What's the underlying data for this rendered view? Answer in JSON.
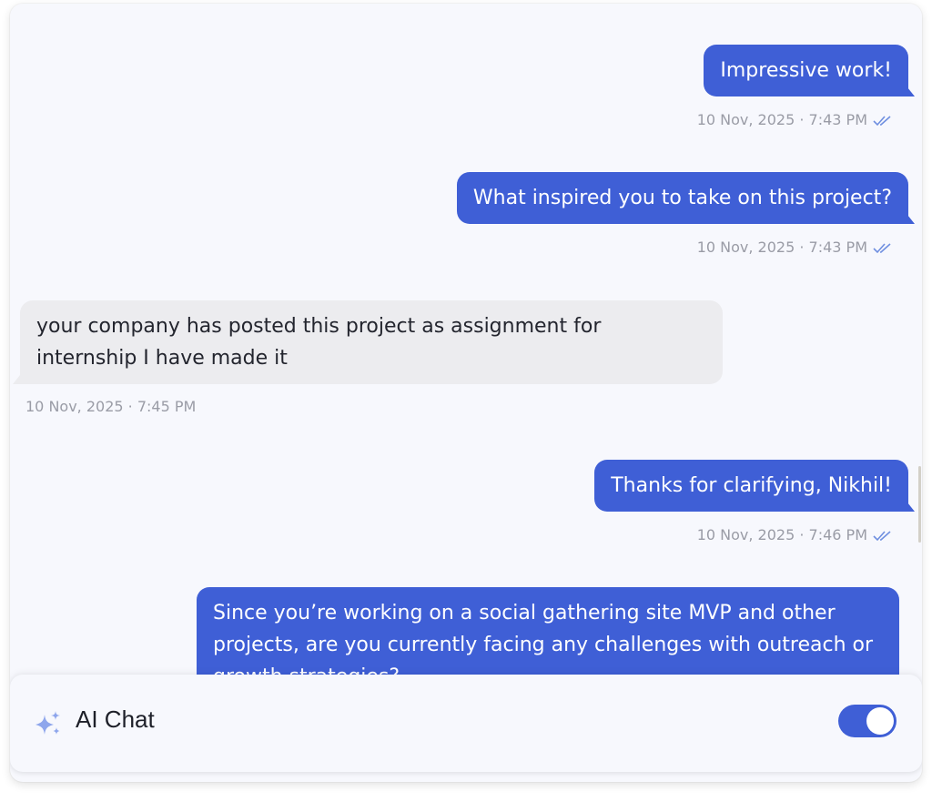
{
  "messages": [
    {
      "direction": "outgoing",
      "text": "Impressive work!",
      "time": "10 Nov, 2025 · 7:43 PM",
      "read": true
    },
    {
      "direction": "outgoing",
      "text": "What inspired you to take on this project?",
      "time": "10 Nov, 2025 · 7:43 PM",
      "read": true
    },
    {
      "direction": "incoming",
      "line1": "your company has posted this project as assignment for",
      "line2": "internship I have made it",
      "time": "10 Nov, 2025 · 7:45 PM"
    },
    {
      "direction": "outgoing",
      "text": "Thanks for clarifying, Nikhil!",
      "time": "10 Nov, 2025 · 7:46 PM",
      "read": true
    },
    {
      "direction": "outgoing",
      "line1": "Since you’re working on a social gathering site MVP and other",
      "line2": "projects, are you currently facing any challenges with outreach or",
      "line3": "growth strategies?"
    }
  ],
  "footer": {
    "label": "AI Chat",
    "toggle_on": true,
    "icon": "sparkle-icon"
  },
  "colors": {
    "accent": "#3f5fd6",
    "incoming_bubble": "#ececef",
    "panel_bg": "#f7f8fd",
    "timestamp": "#9a9ca6",
    "read_ticks": "#6f8fe0"
  }
}
